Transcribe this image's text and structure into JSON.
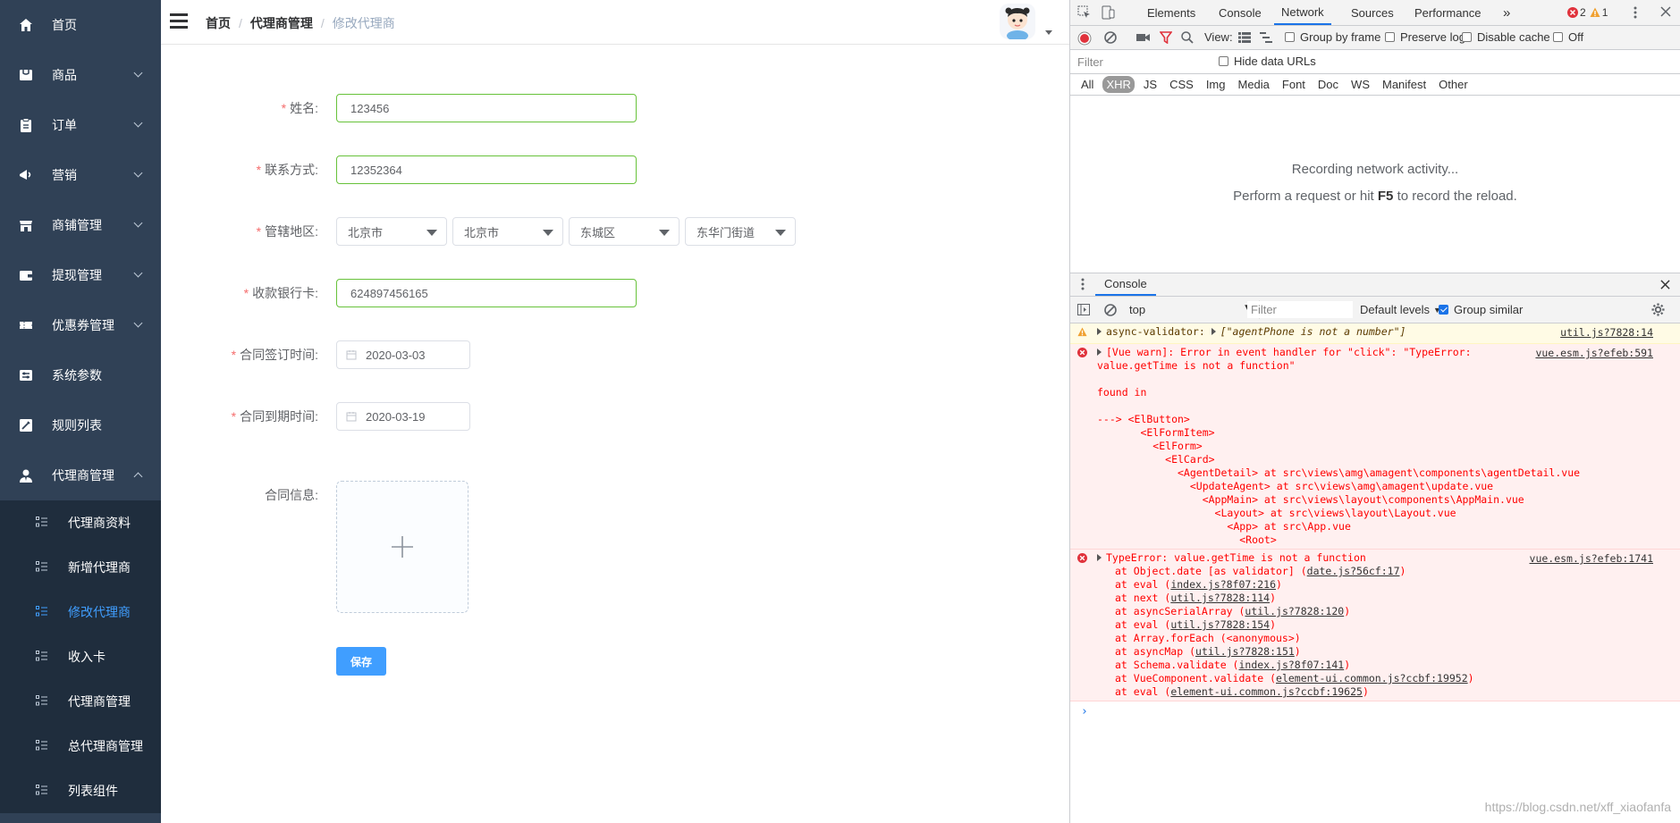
{
  "sidebar": {
    "items": [
      {
        "label": "首页",
        "icon": "home-icon",
        "has_arrow": false
      },
      {
        "label": "商品",
        "icon": "product-icon",
        "has_arrow": true
      },
      {
        "label": "订单",
        "icon": "order-icon",
        "has_arrow": true
      },
      {
        "label": "营销",
        "icon": "marketing-icon",
        "has_arrow": true
      },
      {
        "label": "商铺管理",
        "icon": "shop-icon",
        "has_arrow": true
      },
      {
        "label": "提现管理",
        "icon": "wallet-icon",
        "has_arrow": true
      },
      {
        "label": "优惠券管理",
        "icon": "coupon-icon",
        "has_arrow": true
      },
      {
        "label": "系统参数",
        "icon": "settings-icon",
        "has_arrow": false
      },
      {
        "label": "规则列表",
        "icon": "rules-icon",
        "has_arrow": false
      },
      {
        "label": "代理商管理",
        "icon": "agent-icon",
        "has_arrow": true,
        "expanded": true
      }
    ],
    "submenu": [
      {
        "label": "代理商资料",
        "active": false
      },
      {
        "label": "新增代理商",
        "active": false
      },
      {
        "label": "修改代理商",
        "active": true
      },
      {
        "label": "收入卡",
        "active": false
      },
      {
        "label": "代理商管理",
        "active": false
      },
      {
        "label": "总代理商管理",
        "active": false
      },
      {
        "label": "列表组件",
        "active": false
      }
    ]
  },
  "navbar": {
    "breadcrumb": [
      "首页",
      "代理商管理",
      "修改代理商"
    ],
    "separator": "/"
  },
  "form": {
    "name_label": "姓名:",
    "name_value": "123456",
    "phone_label": "联系方式:",
    "phone_value": "12352364",
    "region_label": "管辖地区:",
    "region_values": [
      "北京市",
      "北京市",
      "东城区",
      "东华门街道"
    ],
    "bank_label": "收款银行卡:",
    "bank_value": "624897456165",
    "sign_label": "合同签订时间:",
    "sign_value": "2020-03-03",
    "expire_label": "合同到期时间:",
    "expire_value": "2020-03-19",
    "contract_label": "合同信息:",
    "required_mark": "*",
    "save_label": "保存"
  },
  "devtools": {
    "tabs": [
      "Elements",
      "Console",
      "Network",
      "Sources",
      "Performance"
    ],
    "active_tab": "Network",
    "more_tabs": "»",
    "error_count": "2",
    "warn_count": "1",
    "view_label": "View:",
    "group_by_frame": "Group by frame",
    "preserve_log": "Preserve log",
    "disable_cache": "Disable cache",
    "offline": "Off",
    "filter_placeholder": "Filter",
    "hide_data_urls": "Hide data URLs",
    "types": [
      "All",
      "XHR",
      "JS",
      "CSS",
      "Img",
      "Media",
      "Font",
      "Doc",
      "WS",
      "Manifest",
      "Other"
    ],
    "active_type": "XHR",
    "recording": "Recording network activity...",
    "perform_prefix": "Perform a request or hit ",
    "perform_key": "F5",
    "perform_suffix": " to record the reload.",
    "drawer_tab": "Console",
    "context": "top",
    "console_filter_placeholder": "Filter",
    "default_levels": "Default levels",
    "group_similar": "Group similar",
    "messages": {
      "warn_text": "async-validator: ",
      "warn_detail": "[\"agentPhone is not a number\"]",
      "warn_src": "util.js?7828:14",
      "err1_text": "[Vue warn]: Error in event handler for \"click\": \"TypeError:\nvalue.getTime is not a function\"\n\nfound in\n\n---> <ElButton>\n       <ElFormItem>\n         <ElForm>\n           <ElCard>\n             <AgentDetail> at src\\views\\amg\\amagent\\components\\agentDetail.vue\n               <UpdateAgent> at src\\views\\amg\\amagent\\update.vue\n                 <AppMain> at src\\views\\layout\\components\\AppMain.vue\n                   <Layout> at src\\views\\layout\\Layout.vue\n                     <App> at src\\App.vue\n                       <Root>",
      "err1_src": "vue.esm.js?efeb:591",
      "err2_head": "TypeError: value.getTime is not a function",
      "err2_src": "vue.esm.js?efeb:1741",
      "stack": [
        {
          "pre": "at Object.date [as validator] (",
          "link": "date.js?56cf:17",
          "post": ")"
        },
        {
          "pre": "at eval (",
          "link": "index.js?8f07:216",
          "post": ")"
        },
        {
          "pre": "at next (",
          "link": "util.js?7828:114",
          "post": ")"
        },
        {
          "pre": "at asyncSerialArray (",
          "link": "util.js?7828:120",
          "post": ")"
        },
        {
          "pre": "at eval (",
          "link": "util.js?7828:154",
          "post": ")"
        },
        {
          "pre": "at Array.forEach (<anonymous>)",
          "link": "",
          "post": ""
        },
        {
          "pre": "at asyncMap (",
          "link": "util.js?7828:151",
          "post": ")"
        },
        {
          "pre": "at Schema.validate (",
          "link": "index.js?8f07:141",
          "post": ")"
        },
        {
          "pre": "at VueComponent.validate (",
          "link": "element-ui.common.js?ccbf:19952",
          "post": ")"
        },
        {
          "pre": "at eval (",
          "link": "element-ui.common.js?ccbf:19625",
          "post": ")"
        }
      ]
    },
    "prompt": "›"
  },
  "watermark": "https://blog.csdn.net/xff_xiaofanfa"
}
